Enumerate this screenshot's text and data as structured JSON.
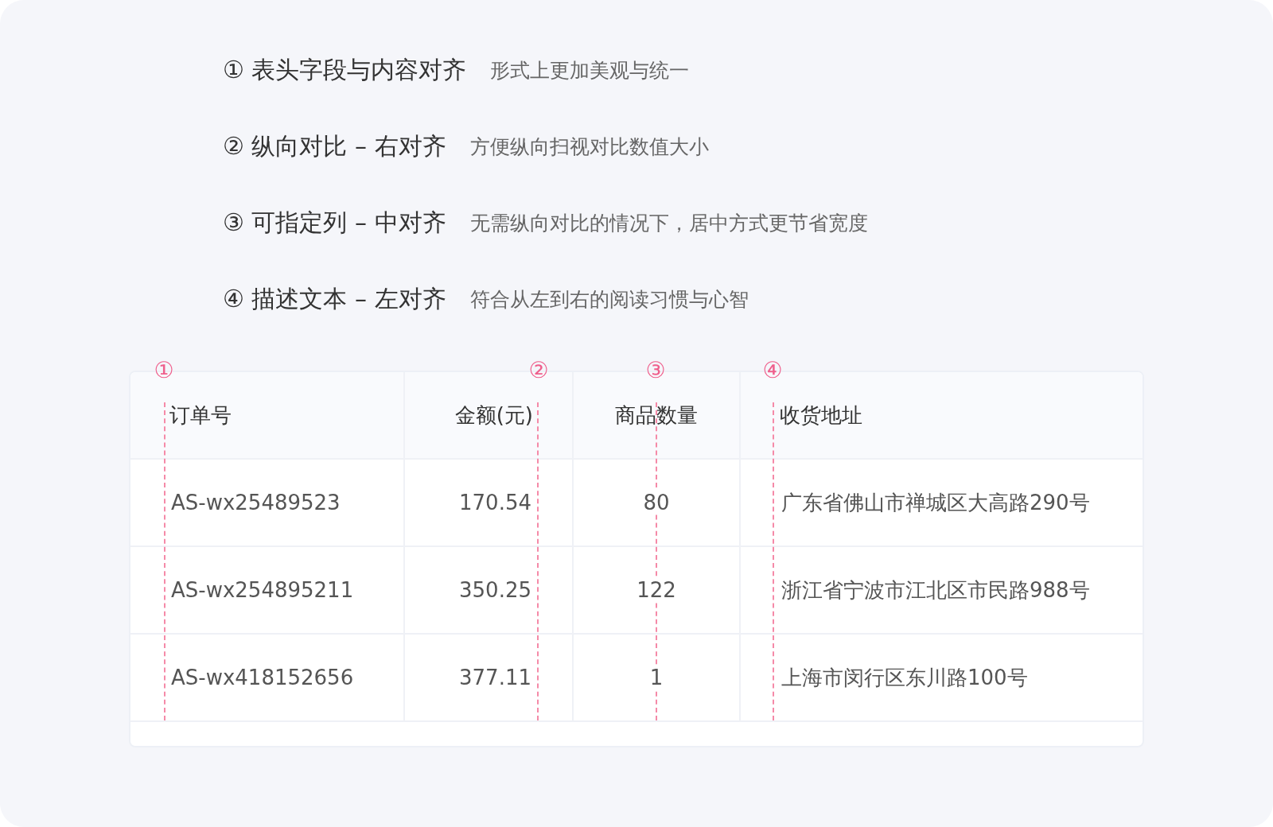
{
  "rules": [
    {
      "number": "①",
      "title": "表头字段与内容对齐",
      "note": "形式上更加美观与统一"
    },
    {
      "number": "②",
      "title": "纵向对比 – 右对齐",
      "note": "方便纵向扫视对比数值大小"
    },
    {
      "number": "③",
      "title": "可指定列 – 中对齐",
      "note": "无需纵向对比的情况下，居中方式更节省宽度"
    },
    {
      "number": "④",
      "title": "描述文本 – 左对齐",
      "note": "符合从左到右的阅读习惯与心智"
    }
  ],
  "table": {
    "columns": [
      {
        "label": "订单号",
        "kind": "left",
        "marker": "①"
      },
      {
        "label": "金额(元)",
        "kind": "right",
        "marker": "②"
      },
      {
        "label": "商品数量",
        "kind": "center",
        "marker": "③"
      },
      {
        "label": "收货地址",
        "kind": "left",
        "marker": "④"
      }
    ],
    "rows": [
      [
        "AS-wx25489523",
        "170.54",
        "80",
        "广东省佛山市禅城区大高路290号"
      ],
      [
        "AS-wx254895211",
        "350.25",
        "122",
        "浙江省宁波市江北区市民路988号"
      ],
      [
        "AS-wx418152656",
        "377.11",
        "1",
        "上海市闵行区东川路100号"
      ]
    ]
  }
}
